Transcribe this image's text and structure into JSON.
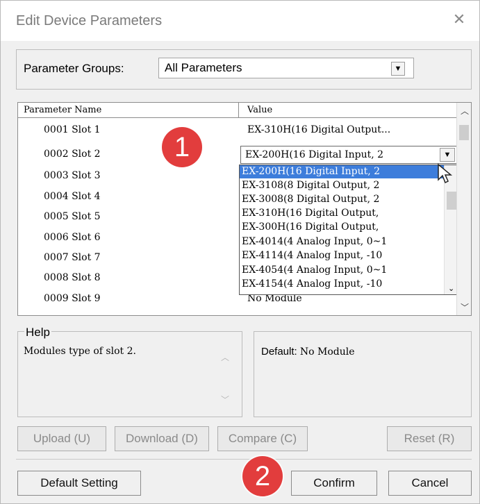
{
  "window": {
    "title": "Edit Device Parameters",
    "close_glyph": "✕"
  },
  "parameter_groups": {
    "label": "Parameter Groups:",
    "selected": "All Parameters"
  },
  "grid": {
    "columns": [
      "Parameter Name",
      "Value"
    ],
    "rows": [
      {
        "name": "0001 Slot 1",
        "value": "EX-310H(16 Digital Output..."
      },
      {
        "name": "0002 Slot 2",
        "value": ""
      },
      {
        "name": "0003 Slot 3",
        "value": ""
      },
      {
        "name": "0004 Slot 4",
        "value": ""
      },
      {
        "name": "0005 Slot 5",
        "value": ""
      },
      {
        "name": "0006 Slot 6",
        "value": ""
      },
      {
        "name": "0007 Slot 7",
        "value": ""
      },
      {
        "name": "0008 Slot 8",
        "value": ""
      },
      {
        "name": "0009 Slot 9",
        "value": "No Module"
      }
    ],
    "editor_value": "EX-200H(16 Digital Input, 2",
    "dropdown_options": [
      "EX-200H(16 Digital Input, 2",
      "EX-3108(8 Digital Output, 2",
      "EX-3008(8 Digital Output, 2",
      "EX-310H(16 Digital Output,",
      "EX-300H(16 Digital Output,",
      "EX-4014(4 Analog Input, 0~1",
      "EX-4114(4 Analog Input, -10",
      "EX-4054(4 Analog Input, 0~1",
      "EX-4154(4 Analog Input, -10"
    ],
    "selected_option_index": 0
  },
  "help": {
    "label": "Help",
    "text": "Modules type of slot 2.",
    "default_label": "Default:",
    "default_value": "No Module"
  },
  "buttons": {
    "upload": "Upload (U)",
    "download": "Download (D)",
    "compare": "Compare (C)",
    "reset": "Reset (R)",
    "default_setting": "Default Setting",
    "confirm": "Confirm",
    "cancel": "Cancel"
  },
  "annotations": {
    "step1": "1",
    "step2": "2"
  },
  "colors": {
    "selection": "#3d7ddb",
    "badge": "#e23d3d"
  }
}
